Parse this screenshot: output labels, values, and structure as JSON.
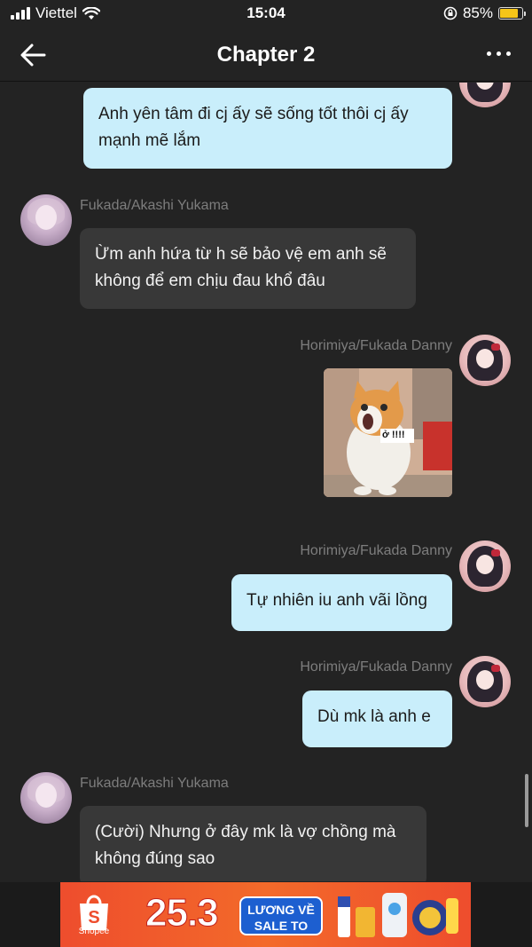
{
  "status_bar": {
    "carrier": "Viettel",
    "time": "15:04",
    "battery": "85%",
    "battery_level": 0.85
  },
  "header": {
    "title": "Chapter 2"
  },
  "messages": [
    {
      "side": "out",
      "text": "Anh yên tâm đi cj ấy sẽ sống tốt thôi cj ấy mạnh mẽ lắm"
    },
    {
      "side": "in",
      "sender": "Fukada/Akashi Yukama",
      "text": "Ừm anh hứa từ h sẽ bảo vệ em anh sẽ không để em chịu đau khổ đâu"
    },
    {
      "side": "out",
      "sender": "Horimiya/Fukada Danny",
      "type": "sticker",
      "sticker_text": "ở !!!!"
    },
    {
      "side": "out",
      "sender": "Horimiya/Fukada Danny",
      "text": "Tự nhiên iu anh vãi lồng"
    },
    {
      "side": "out",
      "sender": "Horimiya/Fukada Danny",
      "text": "Dù mk là anh e"
    },
    {
      "side": "in",
      "sender": "Fukada/Akashi Yukama",
      "text": "(Cười) Nhưng ở đây mk là vợ chồng mà không đúng sao"
    }
  ],
  "ad": {
    "brand": "Shopee",
    "number": "25.3",
    "pill_line1": "LƯƠNG VỀ",
    "pill_line2": "SALE TO"
  },
  "colors": {
    "background": "#232323",
    "outgoing_bubble": "#c9eefb",
    "incoming_bubble": "#383838",
    "ad_brand": "#ee4d2d"
  }
}
